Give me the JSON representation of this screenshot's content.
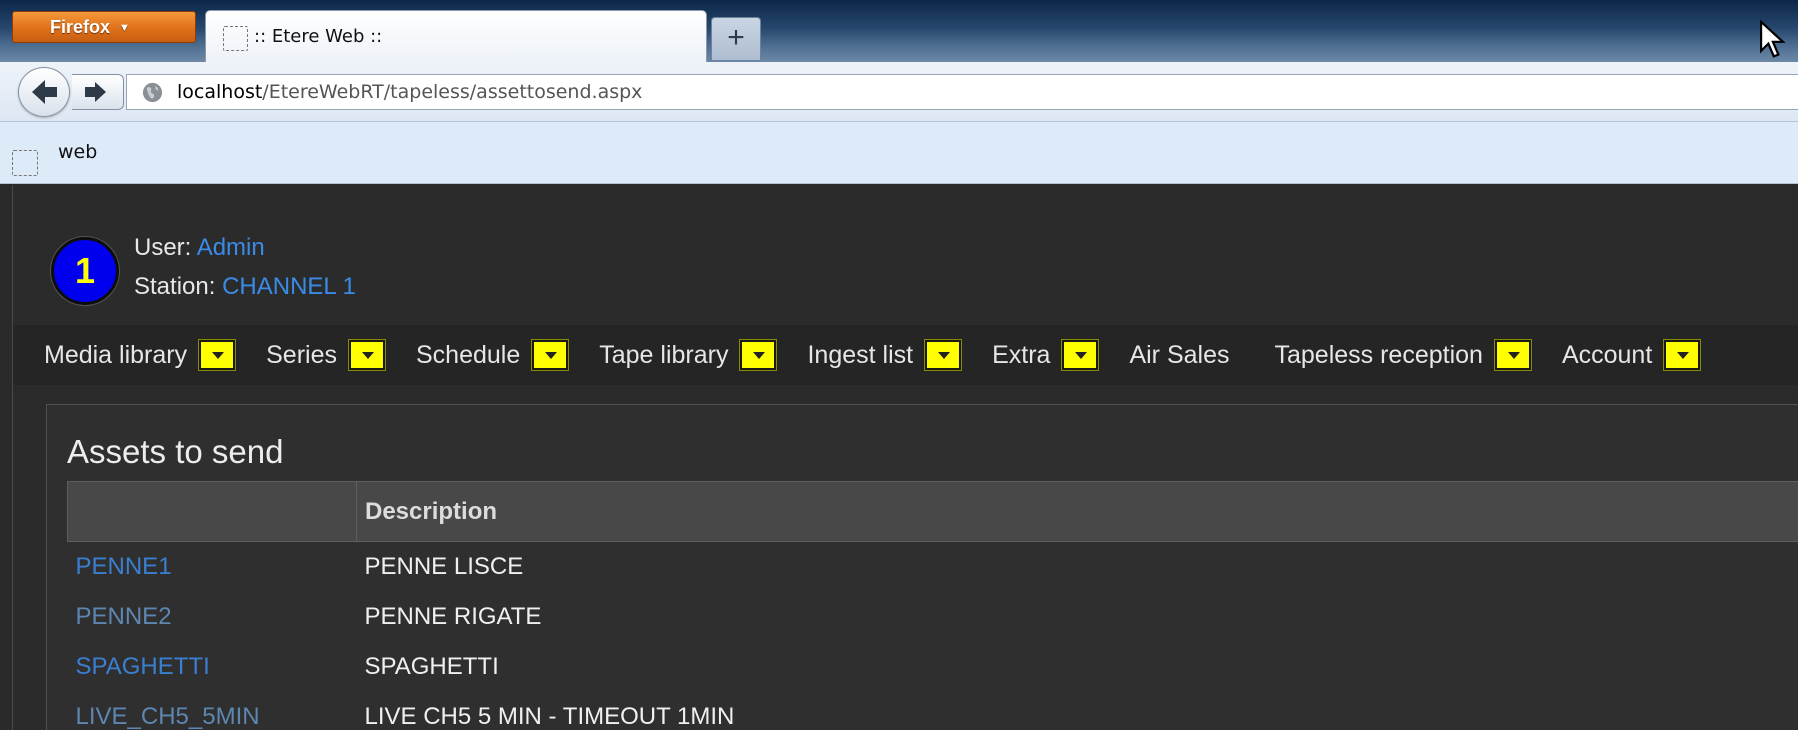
{
  "browser": {
    "menu_button": "Firefox",
    "tab_title": ":: Etere Web ::",
    "new_tab": "+",
    "url_host": "localhost",
    "url_path": "/EtereWebRT/tapeless/assettosend.aspx",
    "bookmark": "web"
  },
  "header": {
    "badge": "1",
    "badge_color": "#0000ee",
    "badge_text_color": "#ffff00",
    "user_label": "User: ",
    "user_value": "Admin",
    "station_label": "Station: ",
    "station_value": "CHANNEL 1",
    "link_color": "#3a8be8"
  },
  "menu": [
    {
      "label": "Media library",
      "has_dropdown": true
    },
    {
      "label": "Series",
      "has_dropdown": true
    },
    {
      "label": "Schedule",
      "has_dropdown": true
    },
    {
      "label": "Tape library",
      "has_dropdown": true
    },
    {
      "label": "Ingest list",
      "has_dropdown": true
    },
    {
      "label": "Extra",
      "has_dropdown": true
    },
    {
      "label": "Air Sales",
      "has_dropdown": false
    },
    {
      "label": "Tapeless reception",
      "has_dropdown": true
    },
    {
      "label": "Account",
      "has_dropdown": true
    }
  ],
  "panel": {
    "title": "Assets to send",
    "columns": [
      "",
      "Description"
    ],
    "rows": [
      {
        "code": "PENNE1",
        "description": "PENNE LISCE"
      },
      {
        "code": "PENNE2",
        "description": "PENNE RIGATE"
      },
      {
        "code": "SPAGHETTI",
        "description": "SPAGHETTI"
      },
      {
        "code": "LIVE_CH5_5MIN",
        "description": "LIVE CH5 5 MIN - TIMEOUT 1MIN"
      }
    ]
  }
}
